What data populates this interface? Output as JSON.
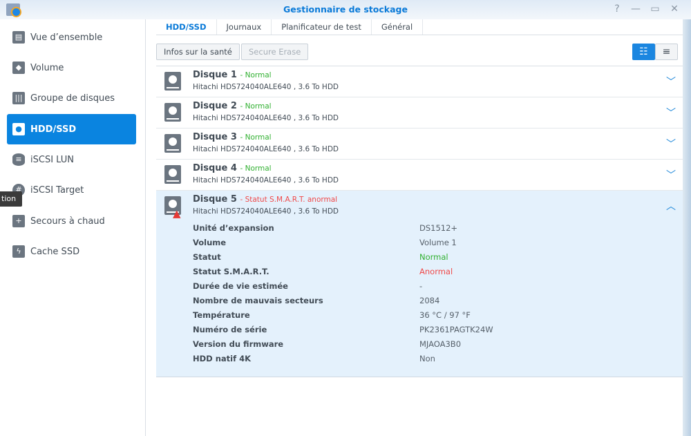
{
  "window": {
    "title": "Gestionnaire de stockage",
    "help": "?",
    "minimize": "—",
    "maximize": "▭",
    "close": "✕"
  },
  "sidebar": {
    "items": [
      {
        "label": "Vue d’ensemble",
        "icon": "overview-icon"
      },
      {
        "label": "Volume",
        "icon": "volume-icon"
      },
      {
        "label": "Groupe de disques",
        "icon": "disk-group-icon"
      },
      {
        "label": "HDD/SSD",
        "icon": "hdd-icon"
      },
      {
        "label": "iSCSI LUN",
        "icon": "database-icon"
      },
      {
        "label": "iSCSI Target",
        "icon": "globe-icon"
      },
      {
        "label": "Secours à chaud",
        "icon": "hot-spare-icon"
      },
      {
        "label": "Cache SSD",
        "icon": "ssd-cache-icon"
      }
    ],
    "active": "HDD/SSD",
    "tooltip": "tion"
  },
  "tabs": [
    "HDD/SSD",
    "Journaux",
    "Planificateur de test",
    "Général"
  ],
  "toolbar": {
    "health": "Infos sur la santé",
    "secure_erase": "Secure Erase"
  },
  "disks": [
    {
      "name": "Disque 1",
      "status": "- Normal",
      "desc": "Hitachi HDS724040ALE640 , 3.6 To HDD"
    },
    {
      "name": "Disque 2",
      "status": "- Normal",
      "desc": "Hitachi HDS724040ALE640 , 3.6 To HDD"
    },
    {
      "name": "Disque 3",
      "status": "- Normal",
      "desc": "Hitachi HDS724040ALE640 , 3.6 To HDD"
    },
    {
      "name": "Disque 4",
      "status": "- Normal",
      "desc": "Hitachi HDS724040ALE640 , 3.6 To HDD"
    },
    {
      "name": "Disque 5",
      "status": "- Statut S.M.A.R.T. anormal",
      "desc": "Hitachi HDS724040ALE640 , 3.6 To HDD"
    }
  ],
  "details": [
    {
      "k": "Unité d’expansion",
      "v": "DS1512+"
    },
    {
      "k": "Volume",
      "v": "Volume 1"
    },
    {
      "k": "Statut",
      "v": "Normal"
    },
    {
      "k": "Statut S.M.A.R.T.",
      "v": "Anormal"
    },
    {
      "k": "Durée de vie estimée",
      "v": "-"
    },
    {
      "k": "Nombre de mauvais secteurs",
      "v": "2084"
    },
    {
      "k": "Température",
      "v": "36 °C / 97 °F"
    },
    {
      "k": "Numéro de série",
      "v": "PK2361PAGTK24W"
    },
    {
      "k": "Version du firmware",
      "v": "MJAOA3B0"
    },
    {
      "k": "HDD natif 4K",
      "v": "Non"
    }
  ],
  "colors": {
    "accent": "#0a84e0",
    "ok": "#30b030",
    "bad": "#f04848"
  }
}
